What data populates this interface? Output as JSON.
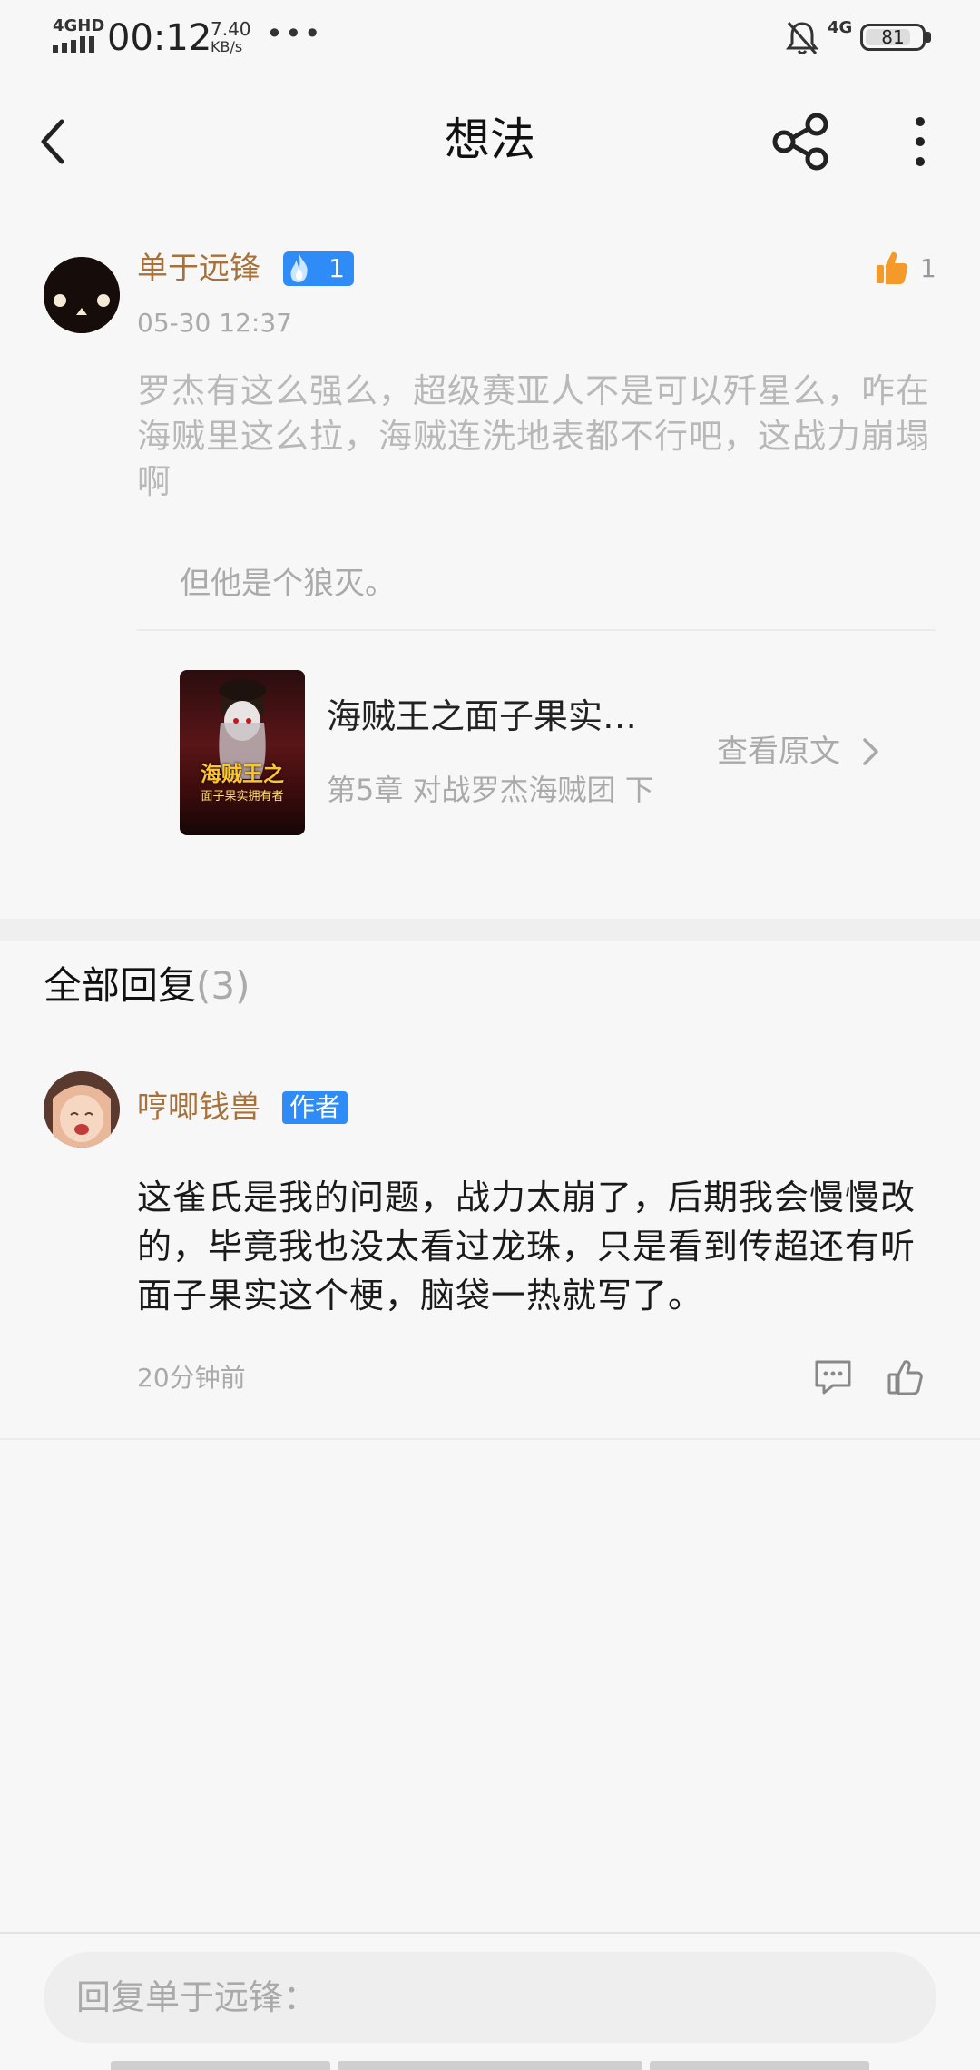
{
  "status_bar": {
    "network": "4GHD",
    "time": "00:12",
    "speed_value": "7.40",
    "speed_unit": "KB/s",
    "more_indicator": "•••",
    "mobile_data": "4G",
    "battery": "81",
    "battery_level": 0.81
  },
  "header": {
    "title": "想法",
    "back_icon": "chevron-left-icon",
    "share_icon": "share-icon",
    "more_icon": "more-vertical-icon"
  },
  "post": {
    "author": "单于远锋",
    "fire_level": "1",
    "date": "05-30 12:37",
    "like_count": "1",
    "text": "罗杰有这么强么，超级赛亚人不是可以歼星么，咋在海贼里这么拉，海贼连洗地表都不行吧，这战力崩塌啊",
    "quote": "但他是个狼灭。",
    "book": {
      "title": "海贼王之面子果实…",
      "chapter": "第5章 对战罗杰海贼团 下",
      "cover_title": "海贼王之",
      "cover_subtitle": "面子果实拥有者",
      "view_original": "查看原文"
    }
  },
  "replies": {
    "heading": "全部回复",
    "count": "(3)",
    "items": [
      {
        "author": "哼唧钱兽",
        "badge": "作者",
        "text": "这雀氏是我的问题，战力太崩了，后期我会慢慢改的，毕竟我也没太看过龙珠，只是看到传超还有听面子果实这个梗，脑袋一热就写了。",
        "time": "20分钟前"
      }
    ]
  },
  "input": {
    "placeholder": "回复单于远锋："
  },
  "colors": {
    "author": "#a9713a",
    "badge_blue": "#2f8cf6",
    "like_orange": "#f39a2b"
  }
}
